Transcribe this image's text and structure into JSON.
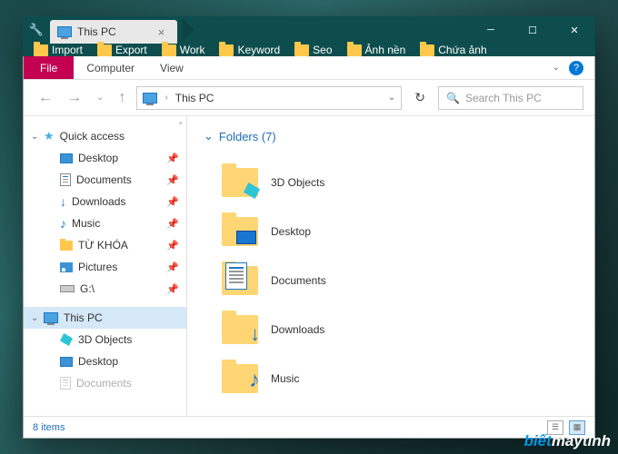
{
  "titlebar": {
    "tab": "This PC"
  },
  "bookmarks": [
    "Import",
    "Export",
    "Work",
    "Keyword",
    "Seo",
    "Ảnh nền",
    "Chứa ảnh"
  ],
  "ribbon": {
    "file": "File",
    "tabs": [
      "Computer",
      "View"
    ]
  },
  "address": {
    "path": "This PC",
    "search_placeholder": "Search This PC"
  },
  "nav": {
    "quick": "Quick access",
    "items": [
      {
        "label": "Desktop",
        "pin": true
      },
      {
        "label": "Documents",
        "pin": true
      },
      {
        "label": "Downloads",
        "pin": true
      },
      {
        "label": "Music",
        "pin": true
      },
      {
        "label": "TỪ KHÓA",
        "pin": true
      },
      {
        "label": "Pictures",
        "pin": true
      },
      {
        "label": "G:\\",
        "pin": true
      }
    ],
    "thispc": "This PC",
    "pc_items": [
      "3D Objects",
      "Desktop",
      "Documents"
    ]
  },
  "main": {
    "section": "Folders (7)",
    "folders": [
      "3D Objects",
      "Desktop",
      "Documents",
      "Downloads",
      "Music"
    ]
  },
  "status": {
    "text": "8 items"
  },
  "watermark": {
    "a": "biết",
    "b": "máytính"
  }
}
